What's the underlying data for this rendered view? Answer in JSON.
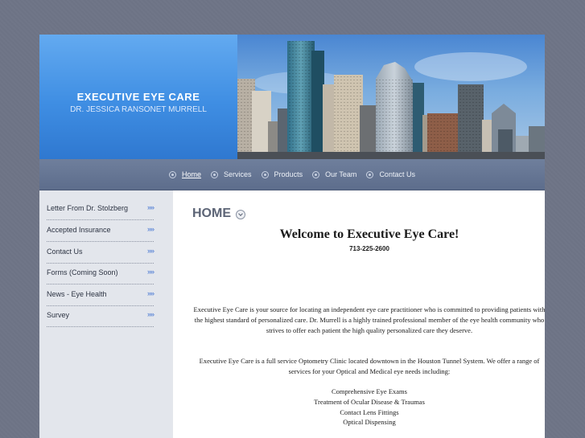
{
  "site": {
    "title": "EXECUTIVE EYE CARE",
    "subtitle": "DR. JESSICA RANSONET MURRELL"
  },
  "nav": [
    {
      "label": "Home",
      "active": true
    },
    {
      "label": "Services"
    },
    {
      "label": "Products"
    },
    {
      "label": "Our Team"
    },
    {
      "label": "Contact Us"
    }
  ],
  "sidebar": {
    "arrow": "»»",
    "items": [
      {
        "label": "Letter From Dr. Stolzberg"
      },
      {
        "label": "Accepted Insurance"
      },
      {
        "label": "Contact Us"
      },
      {
        "label": "Forms (Coming Soon)"
      },
      {
        "label": "News - Eye Health"
      },
      {
        "label": "Survey"
      }
    ]
  },
  "main": {
    "title": "HOME",
    "welcome": "Welcome to Executive Eye Care!",
    "phone": "713-225-2600",
    "para1": "Executive Eye Care is your source for locating an independent eye care practitioner who is committed to providing patients with the highest standard of personalized care. Dr. Murrell is a highly trained professional member of the eye health community who strives to offer each patient the high quality personalized care they deserve.",
    "para2": "Executive Eye Care is a full service Optometry Clinic located downtown in the Houston Tunnel System. We offer a range of services for your Optical and Medical eye needs including:",
    "services": [
      "Comprehensive Eye Exams",
      "Treatment of Ocular Disease & Traumas",
      "Contact Lens Fittings",
      "Optical Dispensing"
    ]
  },
  "colors": {
    "header_blue": "#3f8ee3",
    "nav_bar": "#66769a",
    "sidebar_bg": "#e3e6ec",
    "arrow_blue": "#3b6fd1"
  }
}
